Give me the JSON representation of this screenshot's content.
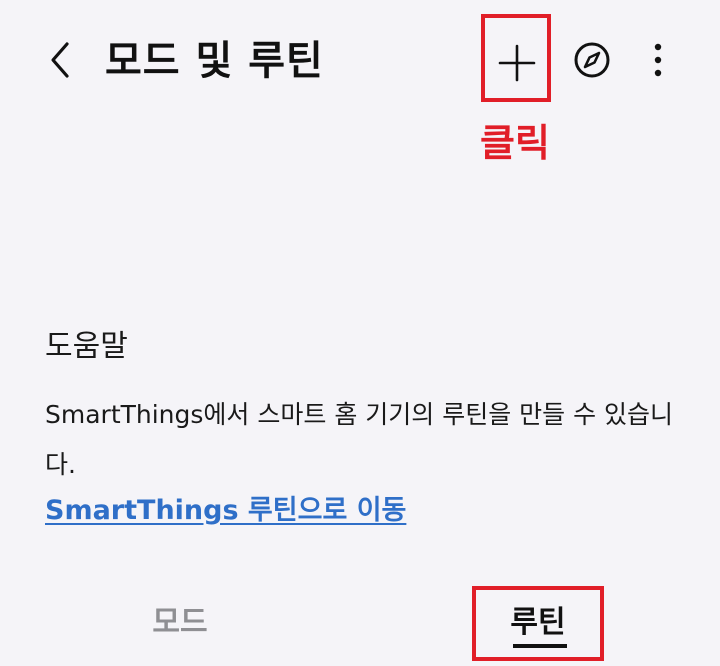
{
  "app_bar": {
    "title": "모드 및 루틴",
    "back_icon": "chevron-left-icon",
    "add_icon": "plus-icon",
    "discover_icon": "compass-icon",
    "more_icon": "more-vertical-icon"
  },
  "annotation": {
    "label": "클릭",
    "color": "#e11e28"
  },
  "help": {
    "title": "도움말",
    "description": "SmartThings에서 스마트 홈 기기의 루틴을 만들 수 있습니다.",
    "link_text": "SmartThings 루틴으로 이동",
    "link_color": "#2f6fc8"
  },
  "tabs": [
    {
      "label": "모드",
      "selected": false
    },
    {
      "label": "루틴",
      "selected": true
    }
  ]
}
